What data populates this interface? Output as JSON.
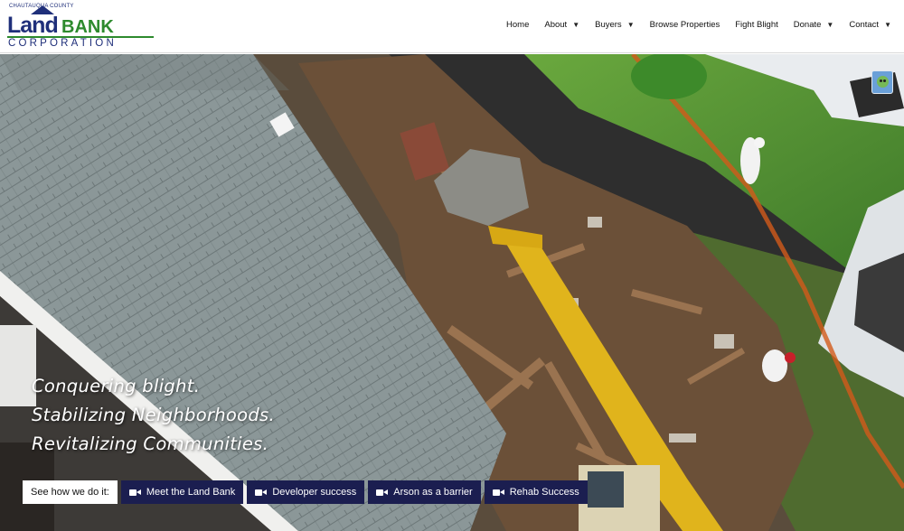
{
  "logo": {
    "county": "CHAUTAUQUA COUNTY",
    "land": "Land",
    "bank": "BANK",
    "corporation": "CORPORATION"
  },
  "nav": [
    {
      "label": "Home",
      "caret": false
    },
    {
      "label": "About",
      "caret": true
    },
    {
      "label": "Buyers",
      "caret": true
    },
    {
      "label": "Browse Properties",
      "caret": false
    },
    {
      "label": "Fight Blight",
      "caret": false
    },
    {
      "label": "Donate",
      "caret": true
    },
    {
      "label": "Contact",
      "caret": true
    }
  ],
  "hero": {
    "taglines": [
      "Conquering blight.",
      "Stabilizing Neighborhoods.",
      "Revitalizing Communities."
    ],
    "buttons": [
      {
        "label": "See how we do it:",
        "icon": null
      },
      {
        "label": "Meet the Land Bank",
        "icon": "video-camera-icon"
      },
      {
        "label": "Developer success",
        "icon": "video-camera-icon"
      },
      {
        "label": "Arson as a barrier",
        "icon": "video-camera-icon"
      },
      {
        "label": "Rehab Success",
        "icon": "video-camera-icon"
      }
    ]
  },
  "colors": {
    "navy": "#1f2f7a",
    "green": "#2d8a2d",
    "button": "#1b1e50"
  }
}
